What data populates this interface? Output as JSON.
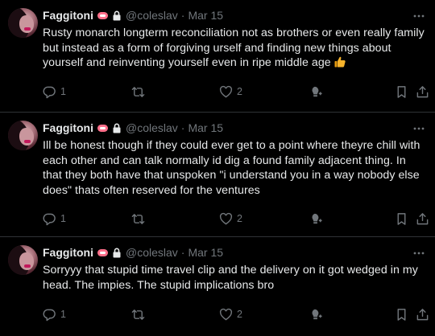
{
  "colors": {
    "background": "#000000",
    "text": "#e7e9ea",
    "muted": "#71767b",
    "divider": "#2f3336"
  },
  "tweets": [
    {
      "display_name": "Faggitoni",
      "handle": "@coleslav",
      "separator": "·",
      "date": "Mar 15",
      "text": "Rusty monarch longterm reconciliation not as brothers or even really family but instead as a form of forgiving urself and finding new things about yourself and reinventing yourself even in ripe middle age",
      "emoji": "thumbs-up",
      "replies": "1",
      "retweets": "",
      "likes": "2"
    },
    {
      "display_name": "Faggitoni",
      "handle": "@coleslav",
      "separator": "·",
      "date": "Mar 15",
      "text": "Ill be honest though if they could ever get to a point where theyre chill with each other and can talk normally id dig a found family adjacent thing. In that they both have that unspoken \"i understand you in a way nobody else does\" thats often reserved for the ventures",
      "replies": "1",
      "retweets": "",
      "likes": "2"
    },
    {
      "display_name": "Faggitoni",
      "handle": "@coleslav",
      "separator": "·",
      "date": "Mar 15",
      "text": "Sorryyy that stupid time travel clip and the delivery on it got wedged in my head. The impies. The stupid implications bro",
      "replies": "1",
      "retweets": "",
      "likes": "2"
    }
  ]
}
